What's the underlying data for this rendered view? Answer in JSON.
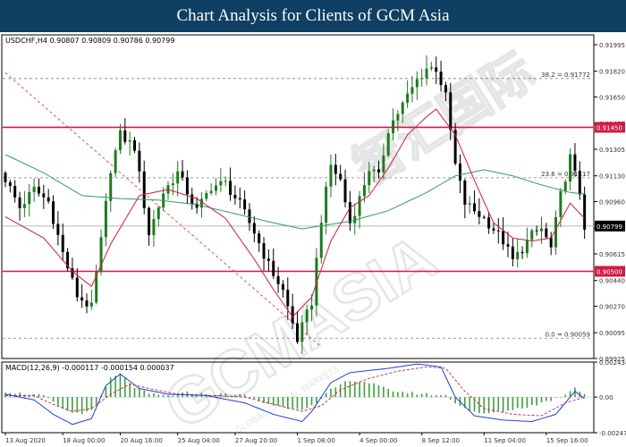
{
  "banner": {
    "title": "Chart Analysis for Clients of GCM Asia"
  },
  "chart_data": [
    {
      "type": "candlestick",
      "header": "USDCHF,H4  0.90807 0.90809 0.90786 0.90799",
      "ylim": [
        0.89925,
        0.9206
      ],
      "y_ticks": [
        "0.91995",
        "0.91820",
        "0.91650",
        "0.91475",
        "0.91305",
        "0.91130",
        "0.90960",
        "0.90785",
        "0.90615",
        "0.90440",
        "0.90270",
        "0.90095",
        "0.89925"
      ],
      "current_price": "0.90799",
      "x_ticks": [
        "13 Aug 2020",
        "18 Aug 00:00",
        "20 Aug 16:00",
        "25 Aug 04:00",
        "27 Aug 20:00",
        "1 Sep 08:00",
        "4 Sep 00:00",
        "8 Sep 12:00",
        "11 Sep 04:00",
        "15 Sep 16:00"
      ],
      "levels": [
        {
          "value": 0.9145,
          "label": "0.91450",
          "color": "#d21a48"
        },
        {
          "value": 0.905,
          "label": "0.90500",
          "color": "#d21a48"
        }
      ],
      "fib_levels": [
        {
          "value": 0.91772,
          "label": "38.2 = 0.91772"
        },
        {
          "value": 0.91117,
          "label": "23.6 = 0.91117"
        },
        {
          "value": 0.90059,
          "label": "0.0 = 0.90059"
        }
      ],
      "close_anchors": [
        [
          0,
          0.9111
        ],
        [
          3,
          0.9092
        ],
        [
          6,
          0.9104
        ],
        [
          9,
          0.9096
        ],
        [
          12,
          0.9062
        ],
        [
          15,
          0.9034
        ],
        [
          18,
          0.9026
        ],
        [
          20,
          0.907
        ],
        [
          22,
          0.9118
        ],
        [
          24,
          0.914
        ],
        [
          27,
          0.9132
        ],
        [
          30,
          0.9075
        ],
        [
          33,
          0.9102
        ],
        [
          36,
          0.9115
        ],
        [
          40,
          0.909
        ],
        [
          43,
          0.9106
        ],
        [
          46,
          0.9108
        ],
        [
          49,
          0.9094
        ],
        [
          52,
          0.9076
        ],
        [
          55,
          0.9054
        ],
        [
          58,
          0.9037
        ],
        [
          61,
          0.9005
        ],
        [
          64,
          0.903
        ],
        [
          66,
          0.9085
        ],
        [
          68,
          0.912
        ],
        [
          70,
          0.911
        ],
        [
          72,
          0.9082
        ],
        [
          74,
          0.9098
        ],
        [
          76,
          0.9118
        ],
        [
          78,
          0.9112
        ],
        [
          80,
          0.9144
        ],
        [
          83,
          0.916
        ],
        [
          86,
          0.9176
        ],
        [
          88,
          0.9184
        ],
        [
          90,
          0.9184
        ],
        [
          92,
          0.9165
        ],
        [
          94,
          0.912
        ],
        [
          96,
          0.9095
        ],
        [
          98,
          0.909
        ],
        [
          100,
          0.9085
        ],
        [
          102,
          0.9078
        ],
        [
          104,
          0.907
        ],
        [
          106,
          0.9057
        ],
        [
          108,
          0.9065
        ],
        [
          110,
          0.9074
        ],
        [
          112,
          0.9078
        ],
        [
          114,
          0.9065
        ],
        [
          116,
          0.91
        ],
        [
          118,
          0.9125
        ],
        [
          120,
          0.9102
        ],
        [
          121,
          0.908
        ]
      ],
      "ma_red": [
        [
          0,
          0.9086
        ],
        [
          8,
          0.9072
        ],
        [
          14,
          0.905
        ],
        [
          18,
          0.904
        ],
        [
          22,
          0.9068
        ],
        [
          28,
          0.91
        ],
        [
          34,
          0.9104
        ],
        [
          40,
          0.9098
        ],
        [
          46,
          0.9085
        ],
        [
          52,
          0.9058
        ],
        [
          56,
          0.9038
        ],
        [
          60,
          0.902
        ],
        [
          64,
          0.9033
        ],
        [
          68,
          0.907
        ],
        [
          72,
          0.9092
        ],
        [
          76,
          0.91
        ],
        [
          80,
          0.9118
        ],
        [
          84,
          0.914
        ],
        [
          88,
          0.9152
        ],
        [
          90,
          0.9157
        ],
        [
          94,
          0.914
        ],
        [
          98,
          0.911
        ],
        [
          102,
          0.9082
        ],
        [
          106,
          0.9072
        ],
        [
          110,
          0.907
        ],
        [
          114,
          0.9072
        ],
        [
          118,
          0.9095
        ],
        [
          121,
          0.9085
        ]
      ],
      "ma_green": [
        [
          0,
          0.9127
        ],
        [
          8,
          0.9115
        ],
        [
          16,
          0.91
        ],
        [
          24,
          0.9098
        ],
        [
          32,
          0.9097
        ],
        [
          40,
          0.9094
        ],
        [
          48,
          0.9088
        ],
        [
          56,
          0.9082
        ],
        [
          62,
          0.9078
        ],
        [
          66,
          0.908
        ],
        [
          72,
          0.9083
        ],
        [
          80,
          0.909
        ],
        [
          88,
          0.9102
        ],
        [
          94,
          0.9113
        ],
        [
          100,
          0.9117
        ],
        [
          106,
          0.9113
        ],
        [
          112,
          0.9107
        ],
        [
          118,
          0.9102
        ],
        [
          121,
          0.9101
        ]
      ],
      "trendlines": [
        {
          "from": [
            0,
            0.9181
          ],
          "to": [
            66,
            0.9
          ]
        }
      ]
    },
    {
      "type": "histogram+line",
      "header": "MACD(12,26,9) -0.000117 -0.000154 0.000037",
      "ylim": [
        -0.002478,
        0.002434
      ],
      "y_ticks": [
        "0.002434",
        "0.00",
        "-0.002478"
      ],
      "hist_anchors": [
        [
          0,
          0.0004
        ],
        [
          4,
          0.0002
        ],
        [
          8,
          0.0001
        ],
        [
          12,
          -0.0009
        ],
        [
          16,
          -0.0012
        ],
        [
          19,
          -0.0006
        ],
        [
          22,
          0.0013
        ],
        [
          24,
          0.0016
        ],
        [
          27,
          0.0007
        ],
        [
          30,
          0.0002
        ],
        [
          34,
          0.0001
        ],
        [
          38,
          0.0003
        ],
        [
          42,
          0.0002
        ],
        [
          46,
          0.0002
        ],
        [
          50,
          0.0001
        ],
        [
          54,
          -0.0004
        ],
        [
          58,
          -0.0007
        ],
        [
          62,
          -0.0008
        ],
        [
          65,
          -0.0005
        ],
        [
          68,
          0.0005
        ],
        [
          72,
          0.0012
        ],
        [
          76,
          0.001
        ],
        [
          80,
          0.0005
        ],
        [
          84,
          0.0003
        ],
        [
          88,
          0.0002
        ],
        [
          92,
          0.0001
        ],
        [
          95,
          -0.0006
        ],
        [
          99,
          -0.0012
        ],
        [
          104,
          -0.001
        ],
        [
          110,
          -0.0006
        ],
        [
          114,
          -0.0002
        ],
        [
          117,
          0.0002
        ],
        [
          119,
          0.0007
        ],
        [
          121,
          0.0002
        ]
      ],
      "signal_anchors": [
        [
          0,
          0.0001
        ],
        [
          6,
          0.0001
        ],
        [
          10,
          -0.0005
        ],
        [
          14,
          -0.001
        ],
        [
          18,
          -0.0008
        ],
        [
          22,
          0.0002
        ],
        [
          26,
          0.0009
        ],
        [
          30,
          0.0006
        ],
        [
          36,
          0.0002
        ],
        [
          44,
          0.0001
        ],
        [
          50,
          0.0
        ],
        [
          56,
          -0.0005
        ],
        [
          62,
          -0.001
        ],
        [
          66,
          -0.0006
        ],
        [
          70,
          0.0005
        ],
        [
          76,
          0.0013
        ],
        [
          82,
          0.0018
        ],
        [
          88,
          0.0021
        ],
        [
          92,
          0.002
        ],
        [
          96,
          0.0004
        ],
        [
          100,
          -0.0008
        ],
        [
          106,
          -0.0012
        ],
        [
          112,
          -0.0013
        ],
        [
          117,
          -0.0004
        ],
        [
          121,
          0.0
        ]
      ],
      "macd_anchors": [
        [
          0,
          0.0002
        ],
        [
          6,
          -0.0002
        ],
        [
          10,
          -0.0012
        ],
        [
          14,
          -0.0019
        ],
        [
          18,
          -0.0015
        ],
        [
          21,
          0.0008
        ],
        [
          24,
          0.0016
        ],
        [
          28,
          0.0006
        ],
        [
          34,
          0.0002
        ],
        [
          42,
          0.0001
        ],
        [
          50,
          -0.0004
        ],
        [
          56,
          -0.0012
        ],
        [
          62,
          -0.0017
        ],
        [
          64,
          -0.001
        ],
        [
          68,
          0.001
        ],
        [
          72,
          0.0017
        ],
        [
          80,
          0.002
        ],
        [
          86,
          0.0023
        ],
        [
          91,
          0.0021
        ],
        [
          94,
          0.0
        ],
        [
          98,
          -0.0013
        ],
        [
          104,
          -0.0016
        ],
        [
          110,
          -0.0017
        ],
        [
          115,
          -0.0012
        ],
        [
          119,
          0.0004
        ],
        [
          121,
          -0.0001
        ]
      ]
    }
  ],
  "colors": {
    "bull": "#1f7a1f",
    "bear": "#000000",
    "ma_red": "#d21a48",
    "ma_green": "#2e9e5b",
    "fib": "#808080",
    "hist": "#3f9f3f",
    "signal": "#d21a48",
    "macd": "#1f3fe0",
    "trend": "#e0402e"
  },
  "watermark": {
    "main": "GCMASIA",
    "cn": "智汇国际",
    "sub": "GLOBAL CAPITAL MARKETS"
  }
}
